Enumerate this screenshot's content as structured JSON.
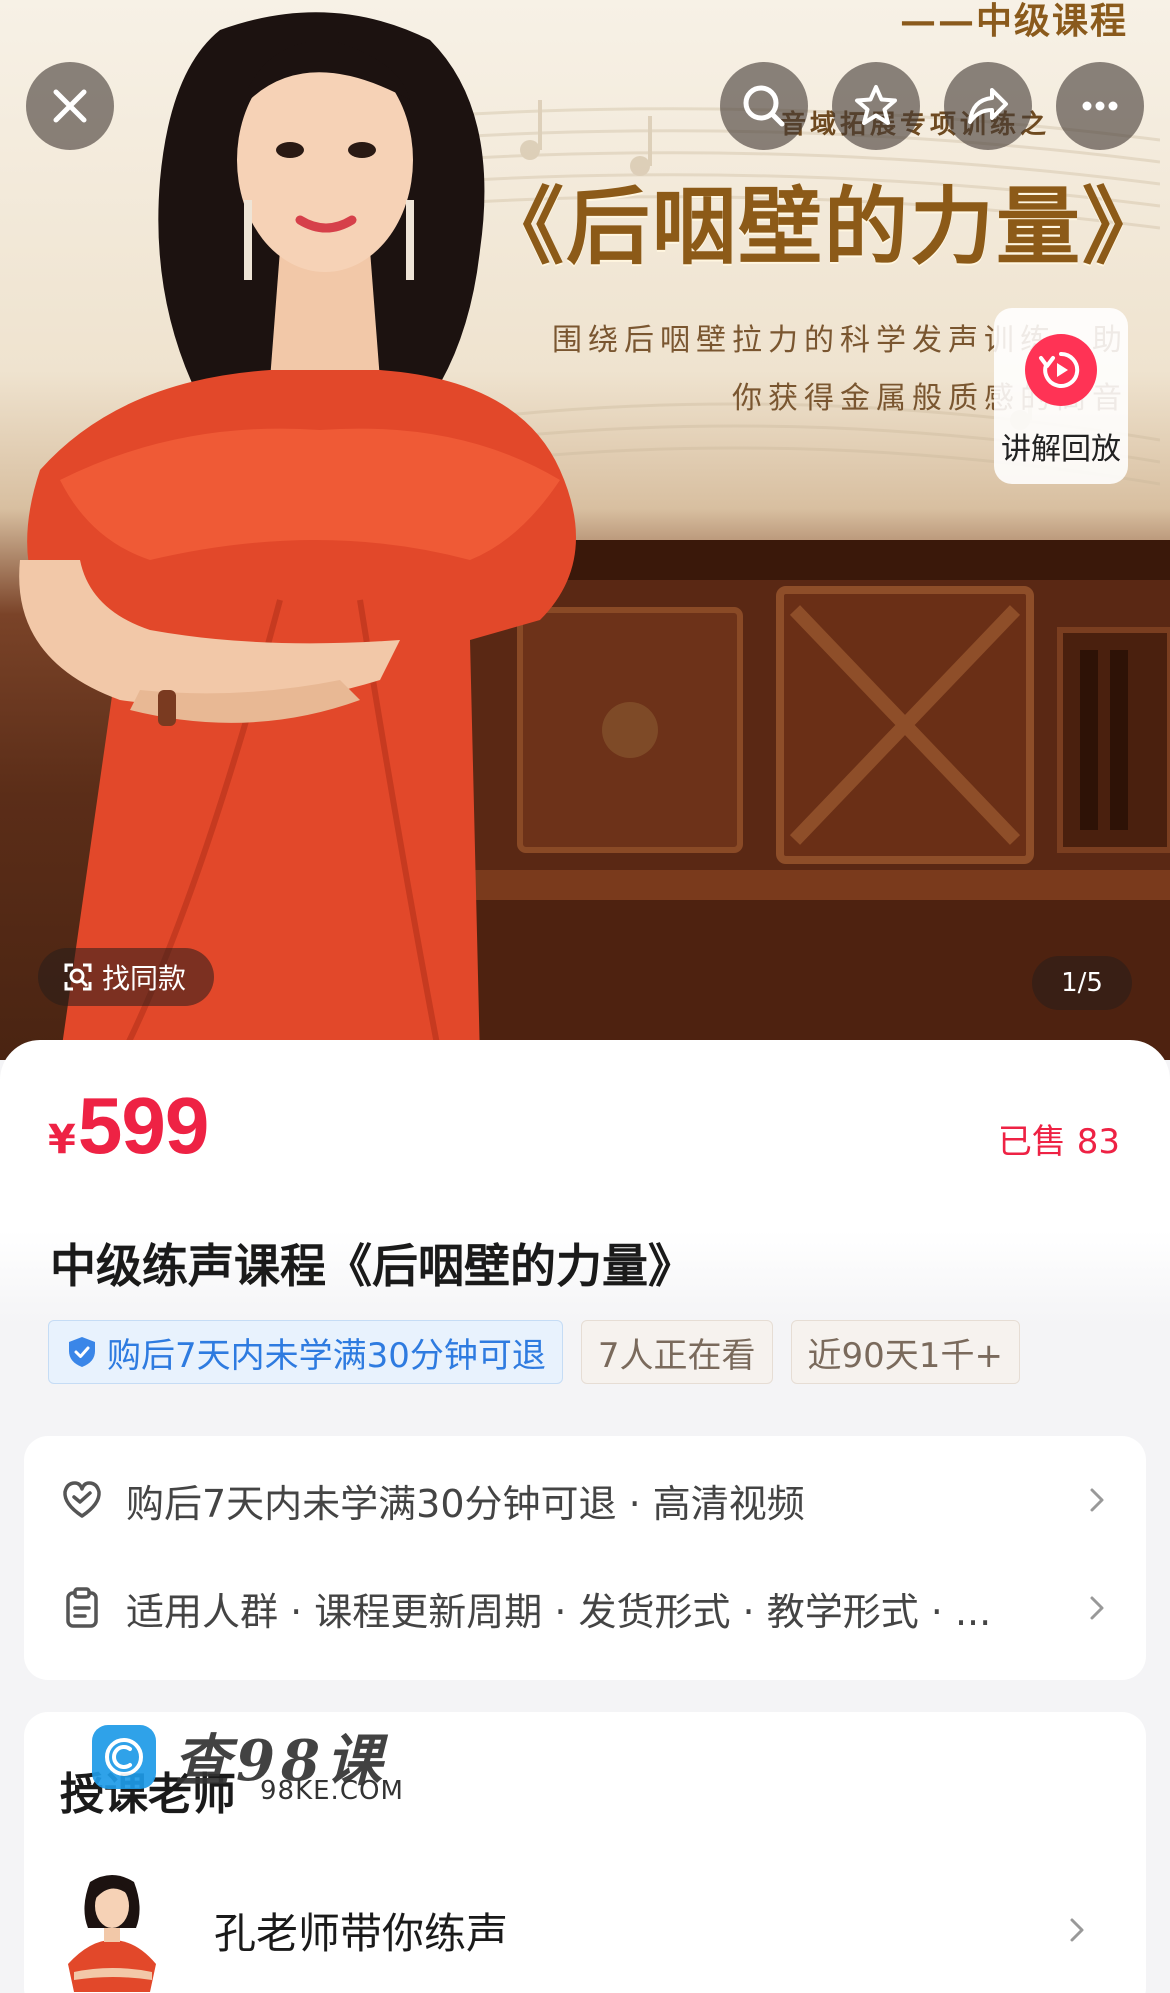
{
  "hero": {
    "subtitle": "——中级课程",
    "kicker": "音域拓展专项训练之",
    "title": "《后咽壁的力量》",
    "description": "围绕后咽壁拉力的科学发声训练，助你获得金属般质感的高音",
    "replay_label": "讲解回放",
    "find_same_label": "找同款",
    "image_counter": "1/5"
  },
  "top_bar": {
    "close_icon": "close-icon",
    "search_icon": "search-icon",
    "favorite_icon": "star-icon",
    "share_icon": "share-icon",
    "more_icon": "more-icon"
  },
  "product": {
    "currency": "¥",
    "price": "599",
    "sold": "已售 83",
    "title": "中级练声课程《后咽壁的力量》",
    "tags": [
      "购后7天内未学满30分钟可退",
      "7人正在看",
      "近90天1千+"
    ]
  },
  "info": {
    "row1": "购后7天内未学满30分钟可退 · 高清视频",
    "row2": "适用人群 · 课程更新周期 · 发货形式 · 教学形式 · ..."
  },
  "teacher": {
    "heading": "授课老师",
    "name": "孔老师带你练声"
  },
  "watermark": {
    "text": "查98课",
    "url": "98KE.COM"
  },
  "colors": {
    "accent": "#ee2244",
    "tag_blue": "#2e7be0"
  }
}
